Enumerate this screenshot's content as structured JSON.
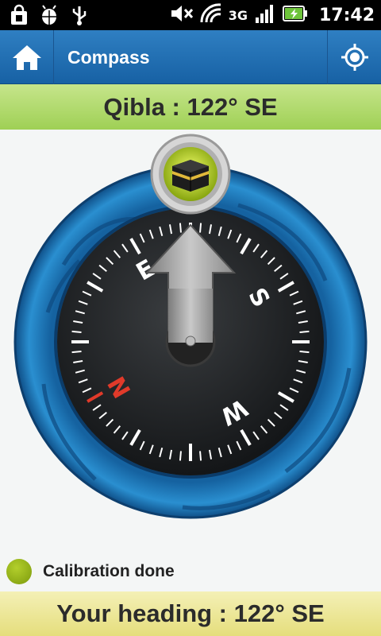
{
  "status_bar": {
    "network": "3G",
    "time": "17:42",
    "icons": [
      "shopping-bag-icon",
      "android-bug-icon",
      "usb-icon",
      "mute-icon",
      "wifi-icon",
      "signal-icon",
      "battery-charging-icon"
    ]
  },
  "app_bar": {
    "title": "Compass",
    "home_icon": "home-icon",
    "locate_icon": "crosshair-icon"
  },
  "qibla": {
    "text": "Qibla : 122° SE"
  },
  "compass": {
    "labels": {
      "north": "N",
      "east": "E",
      "south": "S",
      "west": "W"
    },
    "heading_degrees": 122,
    "qibla_degrees": 122,
    "colors": {
      "ring": "#1c7bc0",
      "dial": "#1c1e20",
      "north": "#e03a2a",
      "marker": "#b9d31f"
    }
  },
  "calibration": {
    "text": "Calibration done",
    "status_color": "#9ab81a"
  },
  "heading": {
    "text": "Your heading : 122° SE"
  }
}
